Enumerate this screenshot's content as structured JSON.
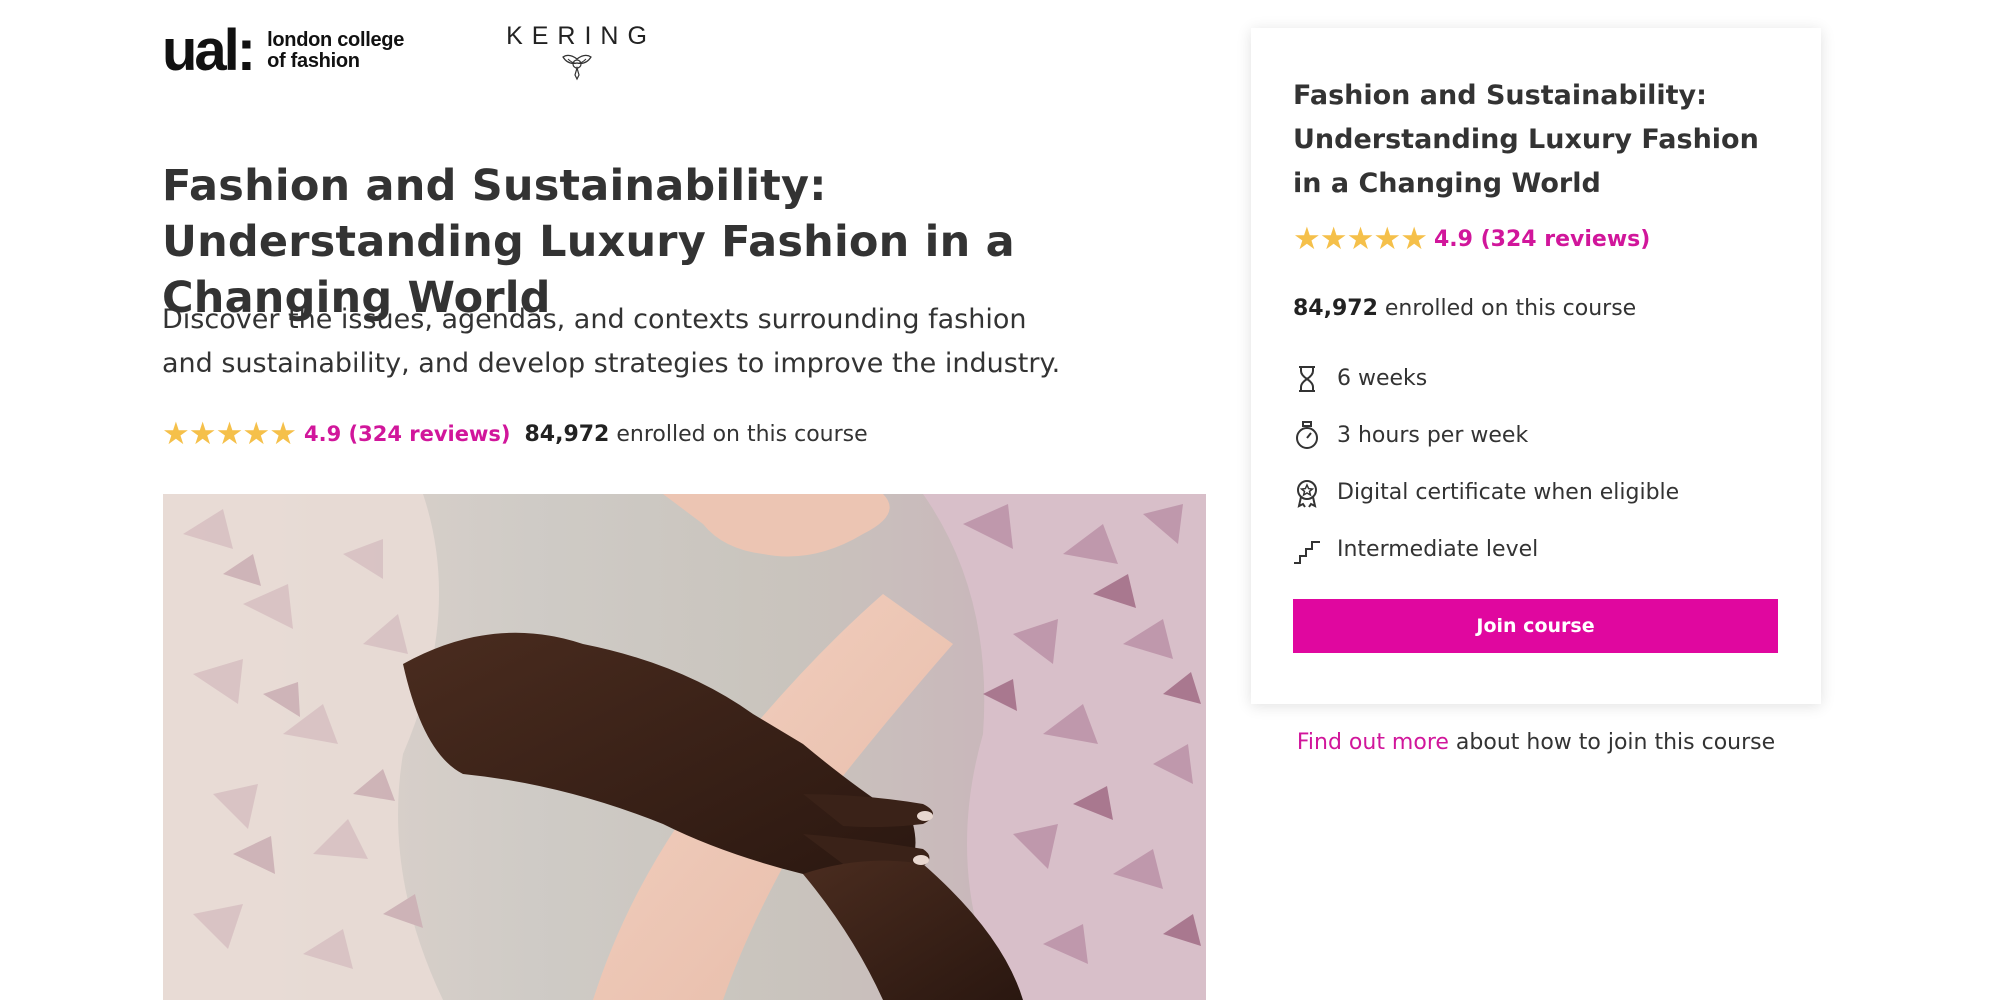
{
  "logos": {
    "ual": {
      "word": "ual:",
      "line1": "london college",
      "line2": "of fashion"
    },
    "kering": {
      "word": "KERING"
    }
  },
  "course": {
    "title": "Fashion and Sustainability: Understanding Luxury Fashion in a Changing World",
    "description": "Discover the issues, agendas, and contexts surrounding fashion and sustainability, and develop strategies to improve the industry.",
    "rating_text": "4.9 (324 reviews)",
    "rating_value": 4.9,
    "stars": 5,
    "enrolled_count": "84,972",
    "enrolled_suffix": " enrolled on this course"
  },
  "card": {
    "title": "Fashion and Sustainability: Understanding Luxury Fashion in a Changing World",
    "rating_text": "4.9 (324 reviews)",
    "enrolled_count": "84,972",
    "enrolled_suffix": " enrolled on this course",
    "features": [
      {
        "icon": "hourglass-icon",
        "label": "6 weeks"
      },
      {
        "icon": "stopwatch-icon",
        "label": "3 hours per week"
      },
      {
        "icon": "certificate-icon",
        "label": "Digital certificate when eligible"
      },
      {
        "icon": "stairs-icon",
        "label": "Intermediate level"
      }
    ],
    "join_label": "Join course"
  },
  "find_more": {
    "link": "Find out more",
    "rest": " about how to join this course"
  },
  "colors": {
    "accent": "#e0079f",
    "link": "#d1169b",
    "star": "#f5c04a",
    "text": "#333333"
  }
}
